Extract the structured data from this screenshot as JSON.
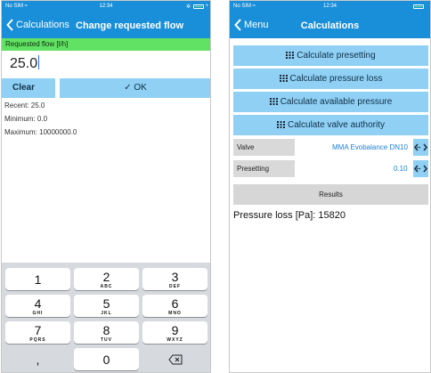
{
  "left_screen": {
    "status": {
      "carrier": "No SIM ≈",
      "time": "12:34",
      "bt": "✲",
      "charge": "+"
    },
    "nav": {
      "back_label": "Calculations",
      "title": "Change requested flow"
    },
    "field": {
      "header": "Requested flow [l/h]",
      "value": "25.0",
      "clear_label": "Clear",
      "ok_label": "✓ OK",
      "recent": "Recent: 25.0",
      "minimum": "Minimum: 0.0",
      "maximum": "Maximum: 10000000.0"
    },
    "keyboard": {
      "keys": [
        {
          "num": "1",
          "sub": ""
        },
        {
          "num": "2",
          "sub": "ABC"
        },
        {
          "num": "3",
          "sub": "DEF"
        },
        {
          "num": "4",
          "sub": "GHI"
        },
        {
          "num": "5",
          "sub": "JKL"
        },
        {
          "num": "6",
          "sub": "MNO"
        },
        {
          "num": "7",
          "sub": "PQRS"
        },
        {
          "num": "8",
          "sub": "TUV"
        },
        {
          "num": "9",
          "sub": "WXYZ"
        },
        {
          "num": ",",
          "sub": ""
        },
        {
          "num": "0",
          "sub": ""
        }
      ]
    }
  },
  "right_screen": {
    "status": {
      "carrier": "No SIM ≈",
      "time": "12:34"
    },
    "nav": {
      "back_label": "Menu",
      "title": "Calculations"
    },
    "buttons": {
      "presetting": "Calculate presetting",
      "pressure_loss": "Calculate pressure loss",
      "available_pressure": "Calculate available pressure",
      "valve_authority": "Calculate valve authority"
    },
    "valve": {
      "label": "Valve",
      "value": "MMA Evobalance DN10"
    },
    "presetting": {
      "label": "Presetting",
      "value": "0.10"
    },
    "results_label": "Results",
    "pressure_loss": {
      "label": "Pressure loss [Pa]:",
      "value": "15820"
    }
  },
  "colors": {
    "nav_blue": "#1a8fd9",
    "button_blue": "#8fd0f4",
    "header_green": "#62e264",
    "value_blue": "#1b7fd6",
    "keyboard_bg": "#d6d9de"
  },
  "icons": [
    "back-chevron-icon",
    "grid-icon",
    "swap-arrows-icon",
    "backspace-icon",
    "battery-icon"
  ]
}
